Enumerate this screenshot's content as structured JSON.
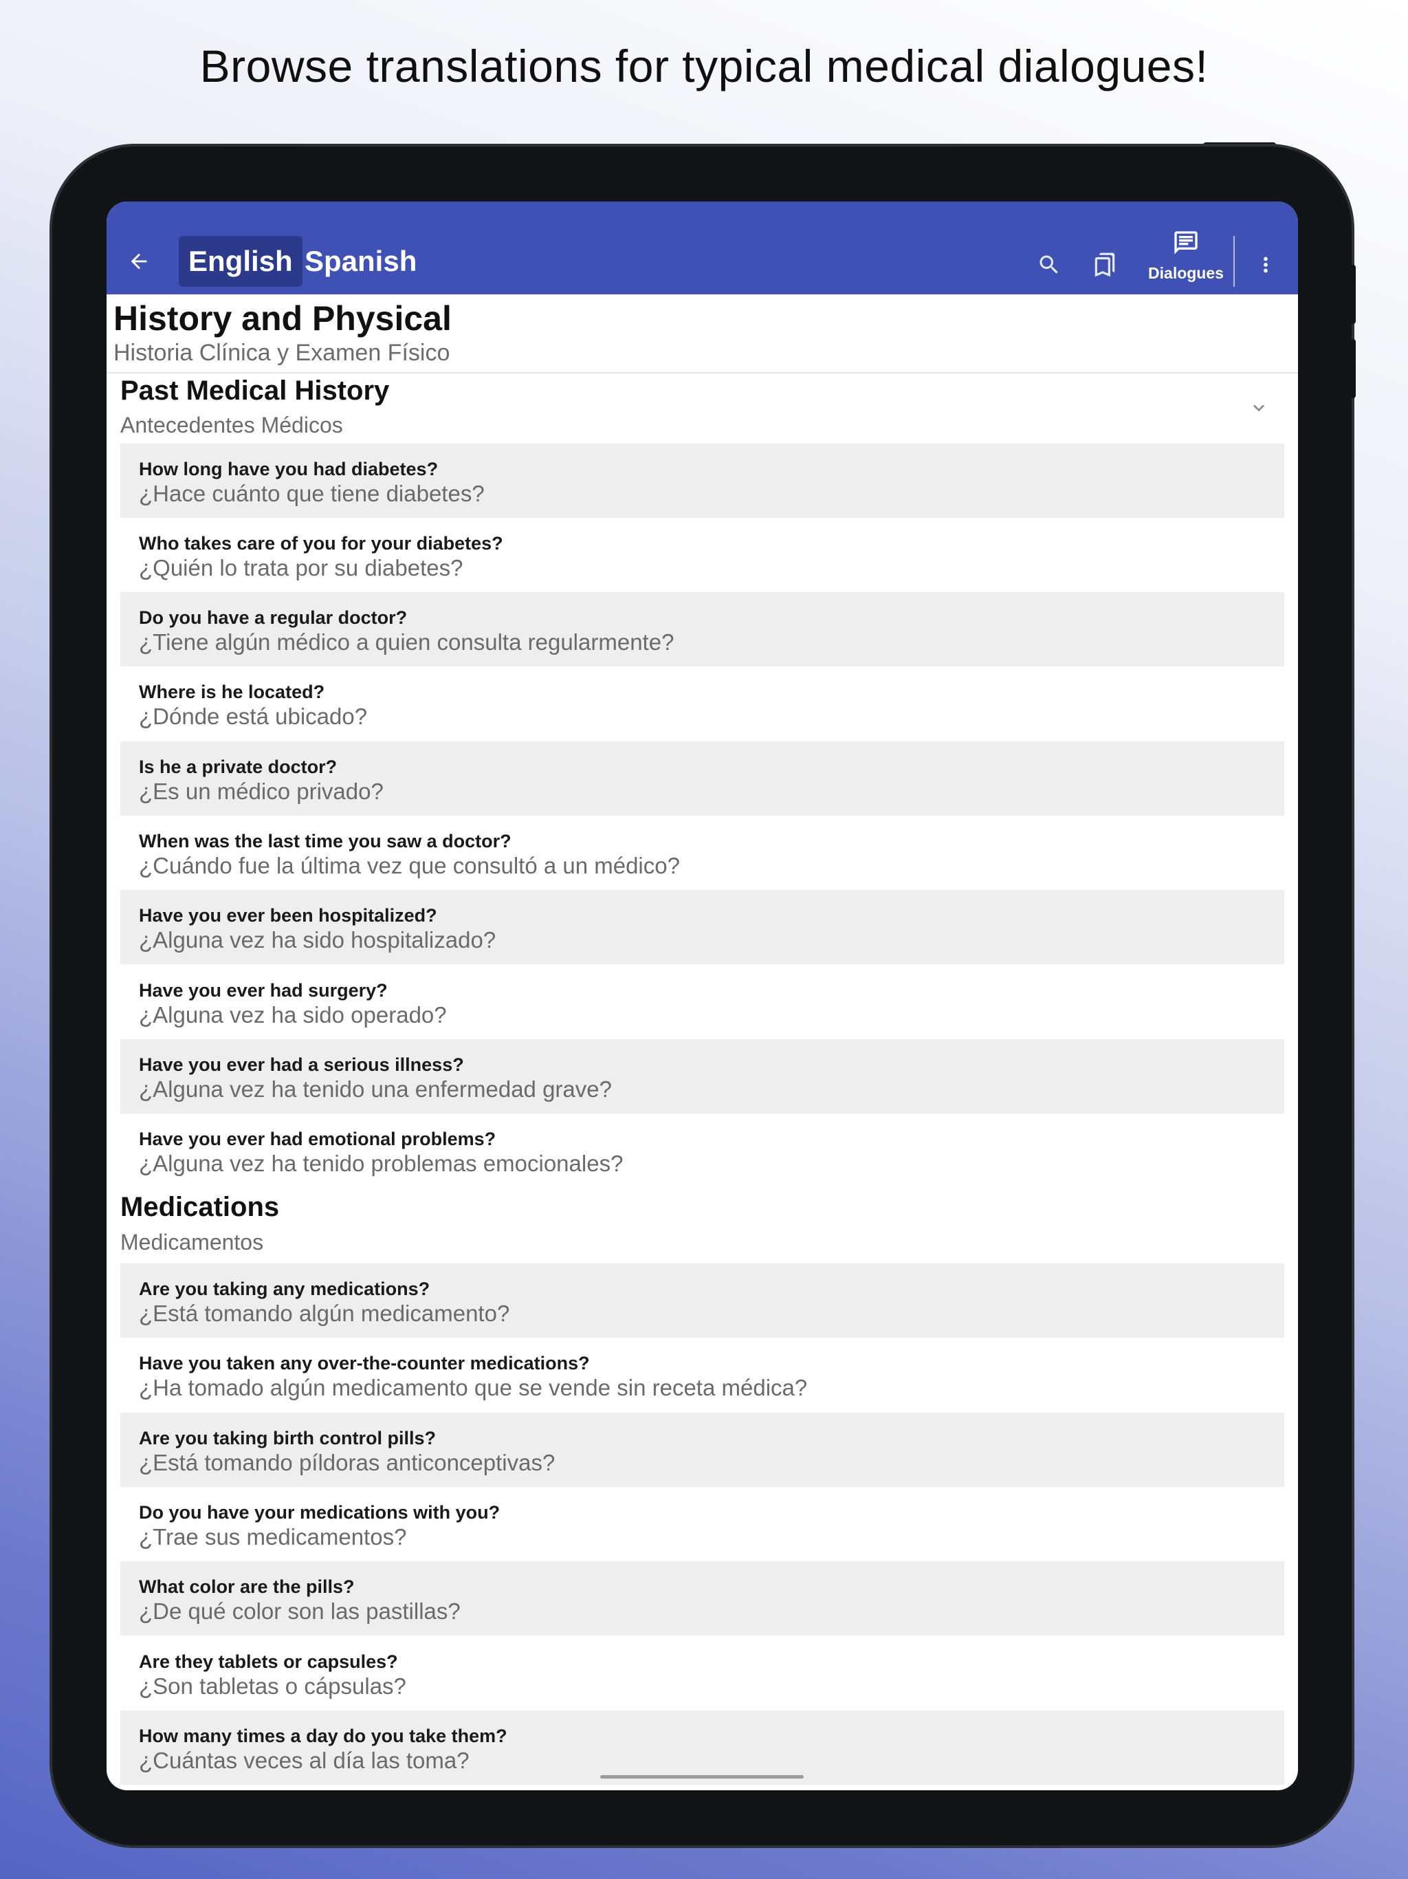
{
  "headline": "Browse translations for typical medical dialogues!",
  "appbar": {
    "languages": [
      "English",
      "Spanish"
    ],
    "active_language": "English",
    "dialogues_label": "Dialogues",
    "icons": [
      "arrow-back-icon",
      "search-icon",
      "bookmarks-icon",
      "dialogues-icon",
      "more-vert-icon"
    ],
    "color": "#3f51b5"
  },
  "page": {
    "title": "History and Physical",
    "subtitle": "Historia Clínica y Examen Físico"
  },
  "sections": [
    {
      "title": "Past Medical History",
      "subtitle": "Antecedentes Médicos",
      "items": [
        {
          "en": "How long have you had diabetes?",
          "es": "¿Hace cuánto que tiene diabetes?"
        },
        {
          "en": "Who takes care of you for your diabetes?",
          "es": "¿Quién lo trata por su diabetes?"
        },
        {
          "en": "Do you have a regular doctor?",
          "es": "¿Tiene algún médico a quien consulta regularmente?"
        },
        {
          "en": "Where is he located?",
          "es": "¿Dónde está ubicado?"
        },
        {
          "en": "Is he a private doctor?",
          "es": "¿Es un médico privado?"
        },
        {
          "en": "When was the last time you saw a doctor?",
          "es": "¿Cuándo fue la última vez que consultó a un médico?"
        },
        {
          "en": "Have you ever been hospitalized?",
          "es": "¿Alguna vez ha sido hospitalizado?"
        },
        {
          "en": "Have you ever had surgery?",
          "es": "¿Alguna vez ha sido operado?"
        },
        {
          "en": "Have you ever had a serious illness?",
          "es": "¿Alguna vez ha tenido una enfermedad grave?"
        },
        {
          "en": "Have you ever had emotional problems?",
          "es": "¿Alguna vez ha tenido problemas emocionales?"
        }
      ]
    },
    {
      "title": "Medications",
      "subtitle": "Medicamentos",
      "items": [
        {
          "en": "Are you taking any medications?",
          "es": "¿Está tomando algún medicamento?"
        },
        {
          "en": "Have you taken any over-the-counter medications?",
          "es": "¿Ha tomado algún medicamento que se vende sin receta médica?"
        },
        {
          "en": "Are you taking birth control pills?",
          "es": "¿Está tomando píldoras anticonceptivas?"
        },
        {
          "en": "Do you have your medications with you?",
          "es": "¿Trae sus medicamentos?"
        },
        {
          "en": "What color are the pills?",
          "es": "¿De qué color son las pastillas?"
        },
        {
          "en": "Are they tablets or capsules?",
          "es": "¿Son tabletas o cápsulas?"
        },
        {
          "en": "How many times a day do you take them?",
          "es": "¿Cuántas veces al día las toma?"
        }
      ]
    }
  ]
}
